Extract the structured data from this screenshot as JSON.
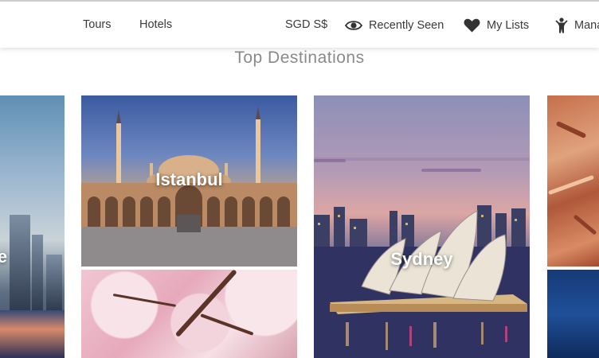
{
  "nav": {
    "tours": "Tours",
    "hotels": "Hotels",
    "currency": "SGD S$",
    "recently_seen": "Recently Seen",
    "my_lists": "My Lists",
    "manage": "Mana"
  },
  "icons": {
    "recently_seen": "eye-icon",
    "my_lists": "heart-icon",
    "manage": "person-icon"
  },
  "section": {
    "title": "Top Destinations"
  },
  "destinations": {
    "istanbul": "Istanbul",
    "sydney": "Sydney",
    "left_partial": "e"
  }
}
